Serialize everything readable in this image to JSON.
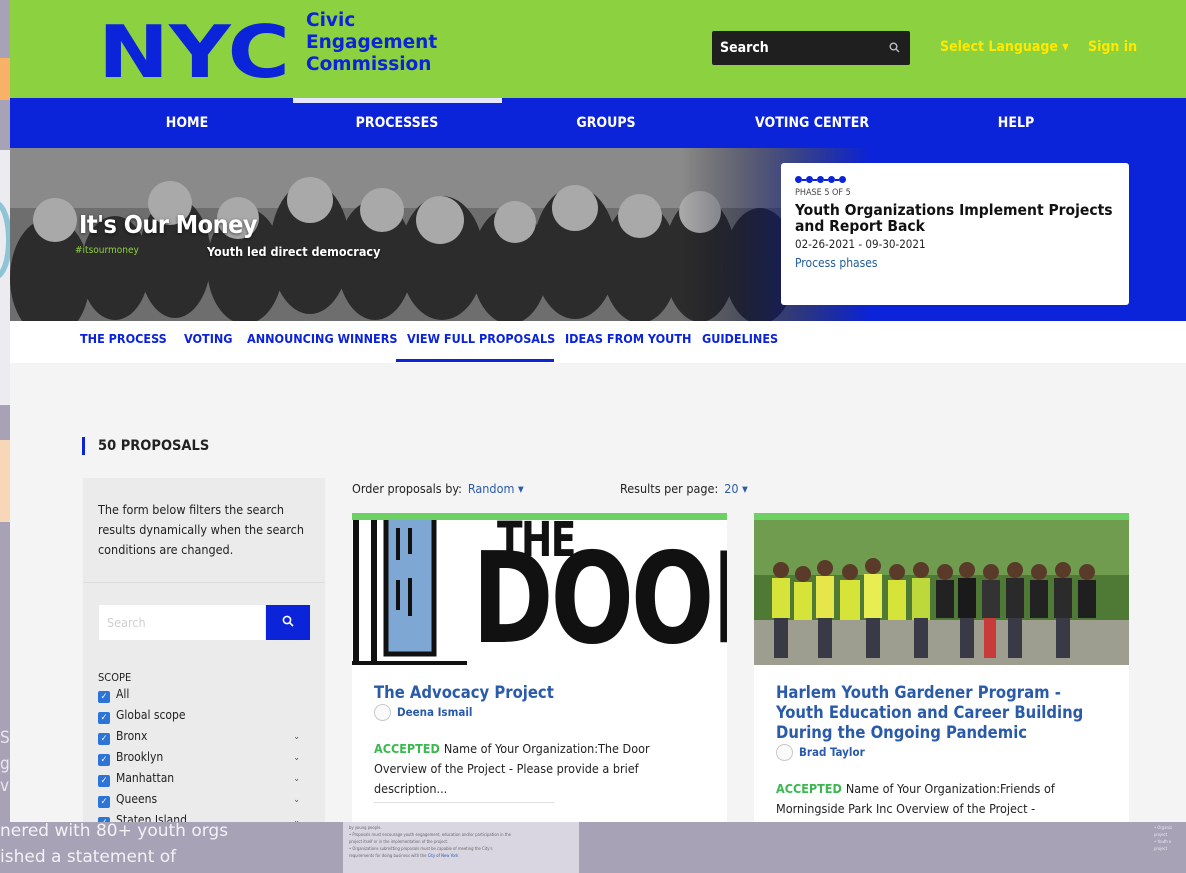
{
  "site": {
    "logo_text": "NYC",
    "commission_name": [
      "Civic",
      "Engagement",
      "Commission"
    ],
    "search_label": "Search",
    "select_language": "Select Language ▾",
    "sign_in": "Sign in"
  },
  "nav": {
    "items": [
      "HOME",
      "PROCESSES",
      "GROUPS",
      "VOTING CENTER",
      "HELP"
    ],
    "active": "PROCESSES"
  },
  "hero": {
    "title": "It's Our Money",
    "hashtag": "#itsourmoney",
    "tagline": "Youth led direct democracy"
  },
  "phase": {
    "label": "PHASE 5 OF 5",
    "title": "Youth Organizations Implement Projects and Report Back",
    "dates": "02-26-2021 - 09-30-2021",
    "link": "Process phases",
    "steps_total": 5,
    "steps_completed": 5
  },
  "subnav": {
    "items": [
      "THE PROCESS",
      "VOTING",
      "ANNOUNCING WINNERS",
      "VIEW FULL PROPOSALS",
      "IDEAS FROM YOUTH",
      "GUIDELINES"
    ],
    "active": "VIEW FULL PROPOSALS"
  },
  "proposals": {
    "count_label": "50 PROPOSALS",
    "order_label": "Order proposals by:",
    "order_value": "Random ▾",
    "per_page_label": "Results per page:",
    "per_page_value": "20 ▾"
  },
  "filter": {
    "description": "The form below filters the search results dynamically when the search conditions are changed.",
    "search_placeholder": "Search",
    "scope_title": "SCOPE",
    "scope_items": [
      {
        "label": "All",
        "checked": true,
        "expandable": false
      },
      {
        "label": "Global scope",
        "checked": true,
        "expandable": false
      },
      {
        "label": "Bronx",
        "checked": true,
        "expandable": true
      },
      {
        "label": "Brooklyn",
        "checked": true,
        "expandable": true
      },
      {
        "label": "Manhattan",
        "checked": true,
        "expandable": true
      },
      {
        "label": "Queens",
        "checked": true,
        "expandable": true
      },
      {
        "label": "Staten Island",
        "checked": true,
        "expandable": true
      }
    ]
  },
  "cards": [
    {
      "title": "The Advocacy Project",
      "author": "Deena Ismail",
      "status": "ACCEPTED",
      "excerpt": "Name of Your Organization:The Door Overview of the Project - Please provide a brief description...",
      "image_words": [
        "THE",
        "DOOR"
      ]
    },
    {
      "title": "Harlem Youth Gardener Program - Youth Education and Career Building During the Ongoing Pandemic",
      "author": "Brad Taylor",
      "status": "ACCEPTED",
      "excerpt": "Name of Your Organization:Friends of Morningside Park Inc Overview of the Project -"
    }
  ],
  "backdrop": {
    "left_text": [
      "nered with 80+ youth orgs",
      "ished a statement of"
    ],
    "left_fragments": [
      "S",
      "g",
      "vi"
    ],
    "bottom_mid_lines": [
      "by young people.",
      "• Proposals must encourage youth engagement, education and/or participation in the",
      "  project itself or in the implementation of the project.",
      "• Organizations submitting proposals must be capable of meeting the City's",
      "  requirements for doing business with the"
    ],
    "bottom_mid_link": "City of New York",
    "bottom_right_lines": [
      "• Organiz",
      "  project",
      "• Youth o",
      "  project"
    ]
  },
  "colors": {
    "header_green": "#8cd13f",
    "brand_blue": "#0b23d9",
    "accepted_green": "#3bb84f",
    "card_top_green": "#6dd063",
    "link_blue": "#2a5aaa",
    "language_yellow": "#ffe900"
  }
}
